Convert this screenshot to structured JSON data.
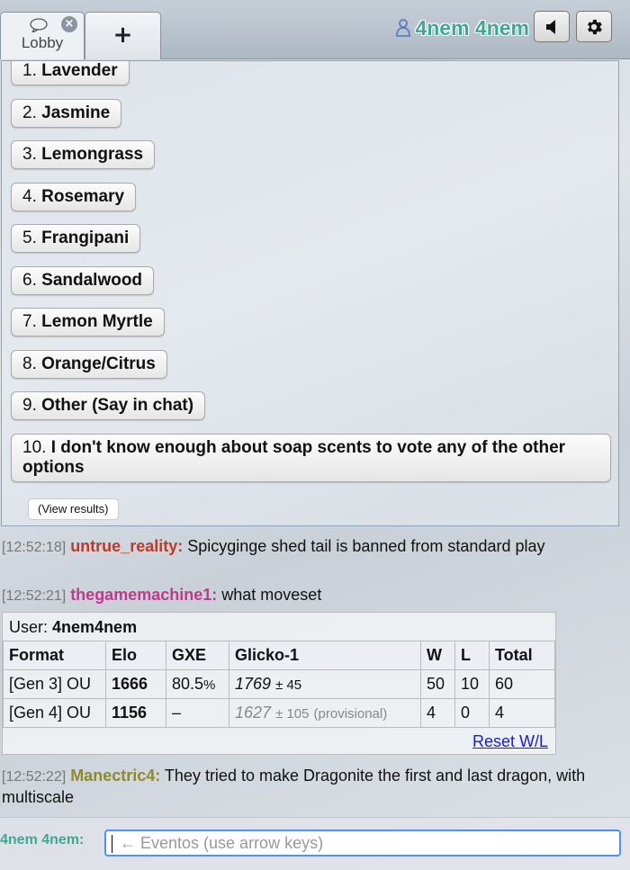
{
  "header": {
    "lobby_tab_label": "Lobby",
    "close_symbol": "×",
    "new_tab_symbol": "+",
    "username": "4nem 4nem",
    "accent_color": "#3fa893",
    "icons": [
      "chat-bubble-icon",
      "close-icon",
      "plus-icon",
      "user-icon",
      "volume-icon",
      "gear-icon"
    ]
  },
  "poll": {
    "options": [
      {
        "num": "1.",
        "label": "Lavender"
      },
      {
        "num": "2.",
        "label": "Jasmine"
      },
      {
        "num": "3.",
        "label": "Lemongrass"
      },
      {
        "num": "4.",
        "label": "Rosemary"
      },
      {
        "num": "5.",
        "label": "Frangipani"
      },
      {
        "num": "6.",
        "label": "Sandalwood"
      },
      {
        "num": "7.",
        "label": "Lemon Myrtle"
      },
      {
        "num": "8.",
        "label": "Orange/Citrus"
      },
      {
        "num": "9.",
        "label": "Other (Say in chat)"
      },
      {
        "num": "10.",
        "label": "I don't know enough about soap scents to vote any of the other options"
      }
    ],
    "view_results_label": "(View results)"
  },
  "chat": [
    {
      "time": "[12:52:18]",
      "user": "untrue_reality:",
      "color": "#c0392b",
      "message": "Spicyginge shed tail is banned from standard play"
    },
    {
      "time": "[12:52:21]",
      "user": "thegamemachine1:",
      "color": "#c0398f",
      "message": "what moveset"
    },
    {
      "time": "[12:52:22]",
      "user": "Manectric4:",
      "color": "#8e8a2c",
      "message": "They tried to make Dragonite the first and last dragon, with multiscale"
    }
  ],
  "rank": {
    "user_label": "User:",
    "user_value": "4nem4nem",
    "headers": [
      "Format",
      "Elo",
      "GXE",
      "Glicko-1",
      "W",
      "L",
      "Total"
    ],
    "rows": [
      {
        "format": "[Gen 3] OU",
        "elo": "1666",
        "gxe": "80.5",
        "gxe_unit": "%",
        "glicko": "1769",
        "glicko_dev": "± 45",
        "provisional": "",
        "w": "50",
        "l": "10",
        "total": "60"
      },
      {
        "format": "[Gen 4] OU",
        "elo": "1156",
        "gxe": "–",
        "gxe_unit": "",
        "glicko": "1627",
        "glicko_dev": "± 105",
        "provisional": "(provisional)",
        "w": "4",
        "l": "0",
        "total": "4"
      }
    ],
    "reset_label": "Reset W/L"
  },
  "input": {
    "user_label": "4nem 4nem:",
    "placeholder": "← Eventos (use arrow keys)"
  }
}
